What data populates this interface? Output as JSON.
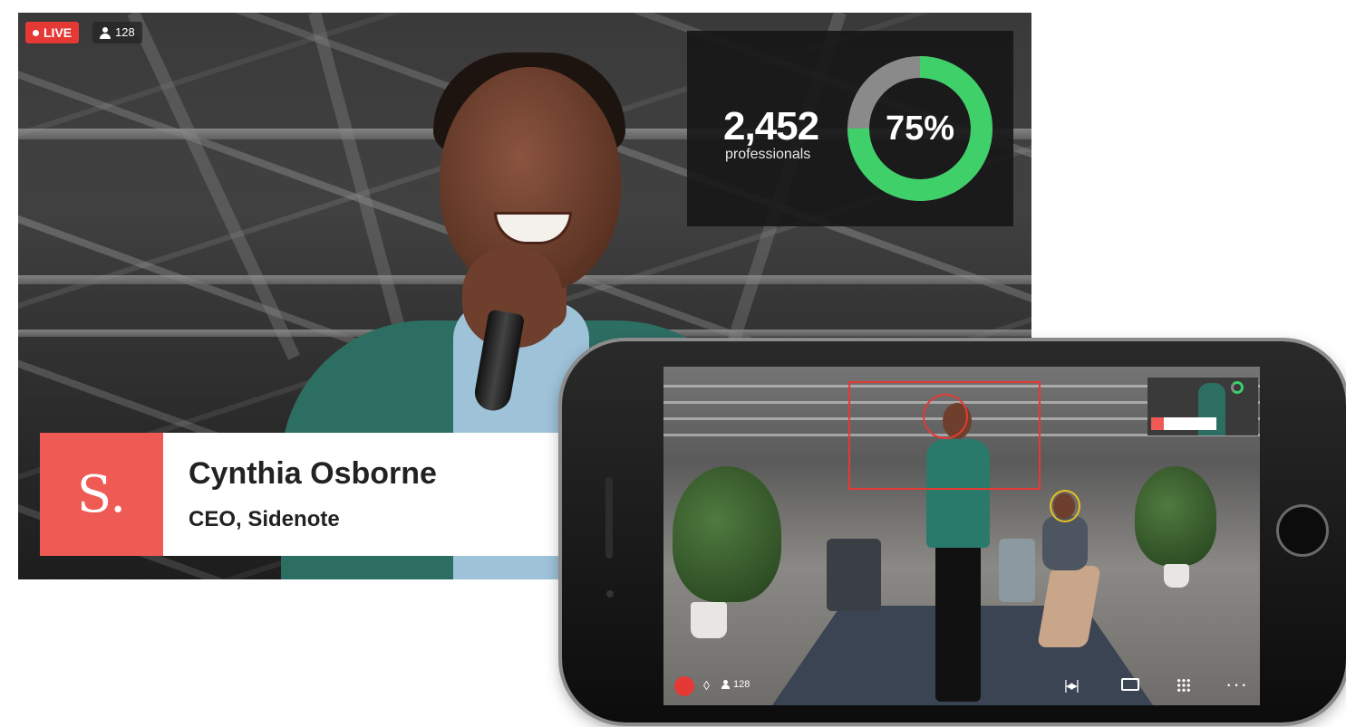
{
  "broadcast": {
    "live_label": "LIVE",
    "viewer_count": "128"
  },
  "stats": {
    "number": "2,452",
    "label": "professionals",
    "percent_label": "75%",
    "percent_value": 75,
    "colors": {
      "progress": "#3fd06a",
      "track": "#8a8a8a"
    }
  },
  "lower_third": {
    "logo": "S.",
    "name": "Cynthia Osborne",
    "title": "CEO, Sidenote",
    "accent_color": "#ef5a55"
  },
  "phone": {
    "viewer_count": "128",
    "controls": {
      "record": "record-icon",
      "audio": "audio-icon",
      "switch": "switch-camera-icon",
      "share": "share-icon",
      "layout": "grid-icon",
      "more": "more-icon"
    },
    "tracking_colors": {
      "primary": "#e53935",
      "secondary": "#e8c11e"
    }
  }
}
